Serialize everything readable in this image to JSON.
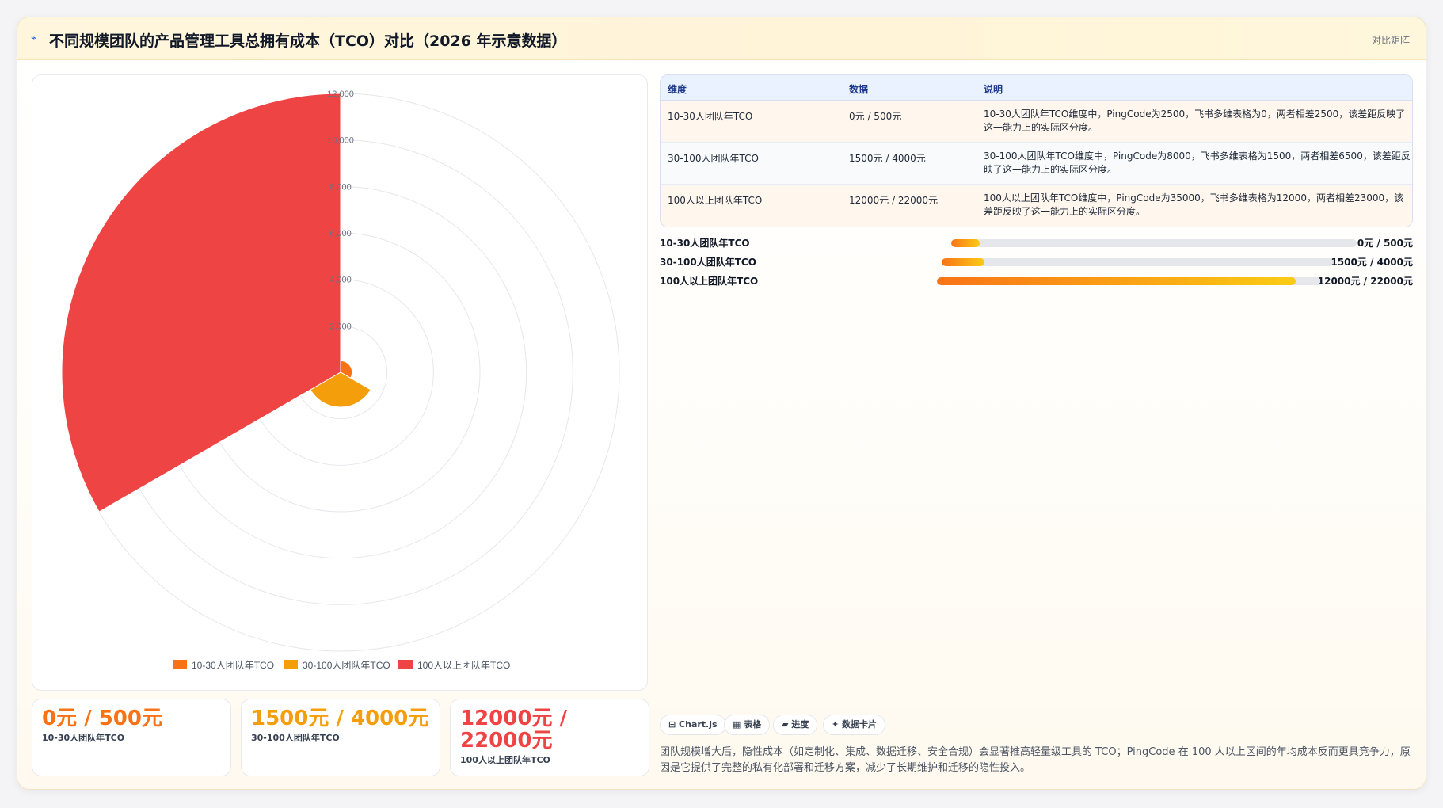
{
  "header": {
    "icon": "chart-line-icon",
    "title": "不同规模团队的产品管理工具总拥有成本（TCO）对比（2026 年示意数据）",
    "badge": "对比矩阵"
  },
  "colors": {
    "series1": "#f97316",
    "series2": "#f59e0b",
    "series3": "#ef4444"
  },
  "chart_data": {
    "type": "polarArea",
    "categories": [
      "10-30人团队年TCO",
      "30-100人团队年TCO",
      "100人以上团队年TCO"
    ],
    "values": [
      500,
      1500,
      12000
    ],
    "rlim": [
      0,
      12000
    ],
    "radial_ticks": [
      "2,000",
      "4,000",
      "6,000",
      "8,000",
      "10,000",
      "12,000"
    ],
    "legend": [
      "10-30人团队年TCO",
      "30-100人团队年TCO",
      "100人以上团队年TCO"
    ],
    "legend_position": "bottom",
    "grid": true
  },
  "kpis": [
    {
      "value": "0元 / 500元",
      "label": "10-30人团队年TCO"
    },
    {
      "value": "1500元 / 4000元",
      "label": "30-100人团队年TCO"
    },
    {
      "value": "12000元 / 22000元",
      "label": "100人以上团队年TCO"
    }
  ],
  "table": {
    "headers": [
      "维度",
      "数据",
      "说明"
    ],
    "rows": [
      {
        "dim": "10-30人团队年TCO",
        "data": "0元 / 500元",
        "desc": "10-30人团队年TCO维度中，PingCode为2500，飞书多维表格为0，两者相差2500，该差距反映了这一能力上的实际区分度。"
      },
      {
        "dim": "30-100人团队年TCO",
        "data": "1500元 / 4000元",
        "desc": "30-100人团队年TCO维度中，PingCode为8000，飞书多维表格为1500，两者相差6500，该差距反映了这一能力上的实际区分度。"
      },
      {
        "dim": "100人以上团队年TCO",
        "data": "12000元 / 22000元",
        "desc": "100人以上团队年TCO维度中，PingCode为35000，飞书多维表格为12000，两者相差23000，该差距反映了这一能力上的实际区分度。"
      }
    ]
  },
  "progress": [
    {
      "label": "10-30人团队年TCO",
      "value_text": "0元 / 500元",
      "fraction": 0.07
    },
    {
      "label": "30-100人团队年TCO",
      "value_text": "1500元 / 4000元",
      "fraction": 0.11
    },
    {
      "label": "100人以上团队年TCO",
      "value_text": "12000元 / 22000元",
      "fraction": 0.93
    }
  ],
  "chips": [
    "⊟ Chart.js",
    "▦ 表格",
    "▰ 进度",
    "✦ 数据卡片"
  ],
  "note": "团队规模增大后，隐性成本（如定制化、集成、数据迁移、安全合规）会显著推高轻量级工具的 TCO；PingCode 在 100 人以上区间的年均成本反而更具竞争力，原因是它提供了完整的私有化部署和迁移方案，减少了长期维护和迁移的隐性投入。"
}
